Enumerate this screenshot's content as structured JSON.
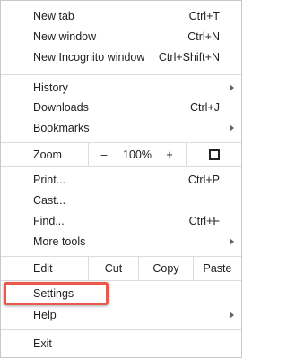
{
  "menu": {
    "items": {
      "new_tab": {
        "label": "New tab",
        "shortcut": "Ctrl+T"
      },
      "new_window": {
        "label": "New window",
        "shortcut": "Ctrl+N"
      },
      "new_incognito": {
        "label": "New Incognito window",
        "shortcut": "Ctrl+Shift+N"
      },
      "history": {
        "label": "History"
      },
      "downloads": {
        "label": "Downloads",
        "shortcut": "Ctrl+J"
      },
      "bookmarks": {
        "label": "Bookmarks"
      },
      "print": {
        "label": "Print...",
        "shortcut": "Ctrl+P"
      },
      "cast": {
        "label": "Cast..."
      },
      "find": {
        "label": "Find...",
        "shortcut": "Ctrl+F"
      },
      "more_tools": {
        "label": "More tools"
      },
      "settings": {
        "label": "Settings"
      },
      "help": {
        "label": "Help"
      },
      "exit": {
        "label": "Exit"
      }
    },
    "zoom": {
      "label": "Zoom",
      "minus": "–",
      "value": "100%",
      "plus": "+",
      "fullscreen_icon": "fullscreen-icon"
    },
    "edit": {
      "label": "Edit",
      "cut": "Cut",
      "copy": "Copy",
      "paste": "Paste"
    }
  },
  "annotation": {
    "highlight_color": "#e8594a",
    "highlighted_item": "settings"
  }
}
